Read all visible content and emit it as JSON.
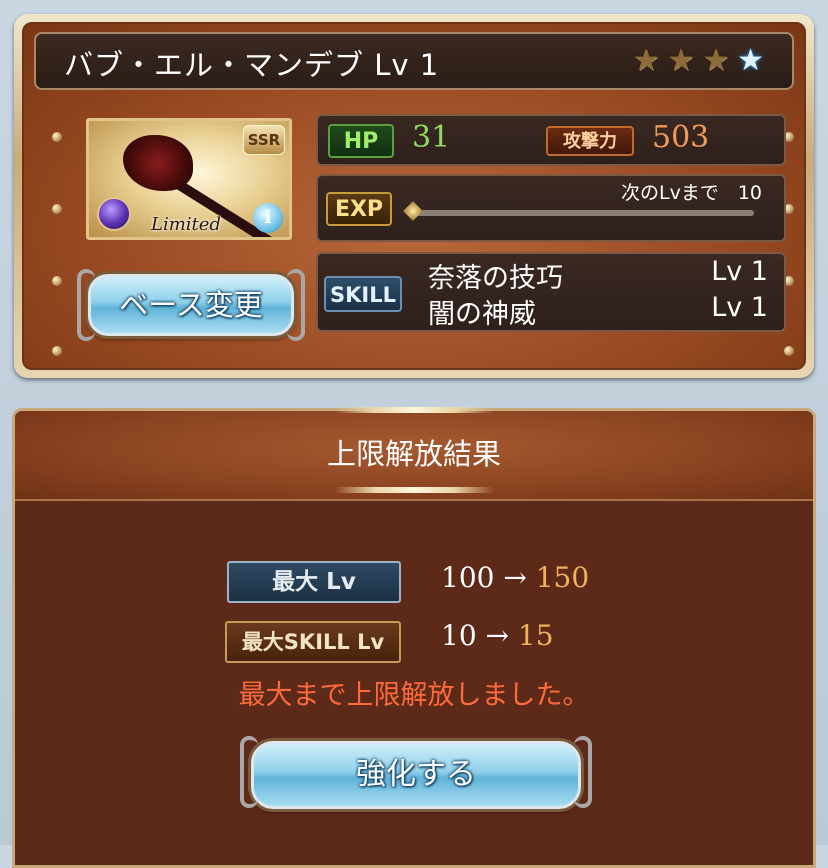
{
  "character": {
    "name": "バブ・エル・マンデブ Lv 1",
    "stars": [
      "star",
      "star",
      "star",
      "star-blue"
    ],
    "rarity": "SSR",
    "tag": "Limited",
    "info_icon": "i"
  },
  "stats": {
    "hp_label": "HP",
    "hp_value": "31",
    "atk_label": "攻撃力",
    "atk_value": "503",
    "exp_label": "EXP",
    "next_lv_text": "次のLvまで　10",
    "exp_progress": 0
  },
  "skills": {
    "label": "SKILL",
    "items": [
      {
        "name": "奈落の技巧",
        "level": "Lv 1"
      },
      {
        "name": "闇の神威",
        "level": "Lv 1"
      }
    ]
  },
  "base_button": "ベース変更",
  "result": {
    "title": "上限解放結果",
    "max_lv_label": "最大 Lv",
    "max_lv_from": "100 →",
    "max_lv_to": "150",
    "max_skill_label": "最大SKILL Lv",
    "max_skill_from": "10 →",
    "max_skill_to": "15",
    "note": "最大まで上限解放しました。",
    "enhance_button": "強化する"
  }
}
